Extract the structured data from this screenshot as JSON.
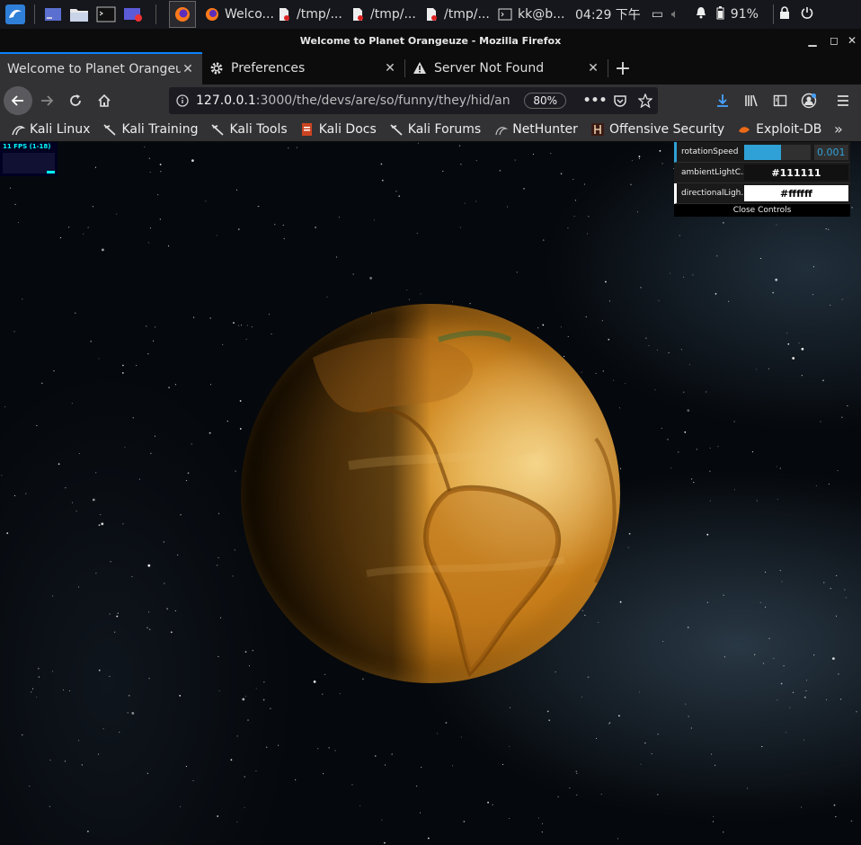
{
  "taskbar": {
    "tasks": [
      {
        "label": "Welco...",
        "icon": "firefox-icon"
      },
      {
        "label": "/tmp/...",
        "icon": "document-icon"
      },
      {
        "label": "/tmp/...",
        "icon": "document-icon"
      },
      {
        "label": "/tmp/...",
        "icon": "document-icon"
      },
      {
        "label": "kk@b...",
        "icon": "terminal-icon"
      }
    ],
    "clock": "04:29 下午",
    "battery": "91%"
  },
  "window": {
    "title": "Welcome to Planet Orangeuze - Mozilla Firefox"
  },
  "tabs": [
    {
      "title": "Welcome to Planet Orangeuze",
      "icon": "none"
    },
    {
      "title": "Preferences",
      "icon": "gear-icon"
    },
    {
      "title": "Server Not Found",
      "icon": "warning-icon"
    }
  ],
  "urlbar": {
    "host": "127.0.0.1",
    "path": ":3000/the/devs/are/so/funny/they/hid/an",
    "zoom": "80%"
  },
  "bookmarks": [
    {
      "label": "Kali Linux",
      "icon": "kali-dragon-icon"
    },
    {
      "label": "Kali Training",
      "icon": "kali-dragon-icon"
    },
    {
      "label": "Kali Tools",
      "icon": "kali-dragon-icon"
    },
    {
      "label": "Kali Docs",
      "icon": "kali-docs-icon"
    },
    {
      "label": "Kali Forums",
      "icon": "kali-dragon-icon"
    },
    {
      "label": "NetHunter",
      "icon": "nethunter-icon"
    },
    {
      "label": "Offensive Security",
      "icon": "offsec-icon"
    },
    {
      "label": "Exploit-DB",
      "icon": "exploitdb-icon"
    }
  ],
  "stats": {
    "fps_text": "11 FPS (1-18)"
  },
  "gui": {
    "rotation": {
      "label": "rotationSpeed",
      "value": "0.001",
      "fill_fraction": 0.55
    },
    "ambient": {
      "label": "ambientLightC...",
      "value": "#111111",
      "bg": "#111111",
      "fg": "#ffffff"
    },
    "directional": {
      "label": "directionalLigh...",
      "value": "#ffffff",
      "bg": "#ffffff",
      "fg": "#000000"
    },
    "close_label": "Close Controls"
  },
  "colors": {
    "accent": "#0a84ff",
    "gui_number": "#2fa1d6",
    "planet": "#c77d1a"
  }
}
